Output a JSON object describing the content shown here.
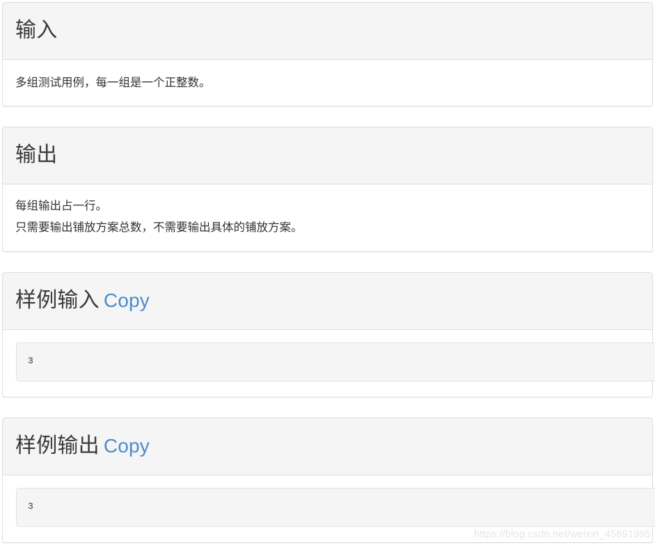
{
  "panels": [
    {
      "id": "input",
      "title": "输入",
      "has_copy": false,
      "copy_label": "",
      "body_lines": [
        "多组测试用例，每一组是一个正整数。"
      ],
      "code": ""
    },
    {
      "id": "output",
      "title": "输出",
      "has_copy": false,
      "copy_label": "",
      "body_lines": [
        "每组输出占一行。",
        "只需要输出铺放方案总数，不需要输出具体的铺放方案。"
      ],
      "code": ""
    },
    {
      "id": "sample-input",
      "title": "样例输入",
      "has_copy": true,
      "copy_label": "Copy",
      "body_lines": [],
      "code": "3"
    },
    {
      "id": "sample-output",
      "title": "样例输出",
      "has_copy": true,
      "copy_label": "Copy",
      "body_lines": [],
      "code": "3"
    }
  ],
  "watermark": {
    "text": "https://blog.csdn.net/weixin_45691995"
  },
  "colors": {
    "link": "#4a8ccc",
    "heading_bg": "#f5f5f5",
    "border": "#dddddd",
    "text": "#333333",
    "code_bg": "#f5f5f5",
    "watermark": "#e3e5e7"
  }
}
